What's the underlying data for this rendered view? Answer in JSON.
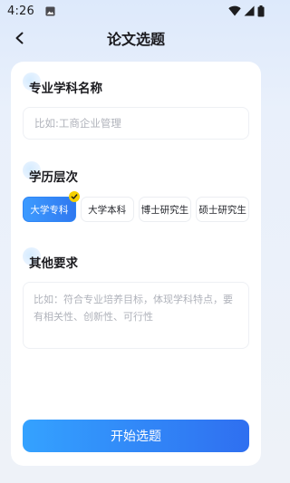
{
  "status_bar": {
    "time": "4:26",
    "icons": [
      "image-icon",
      "wifi-icon",
      "signal-icon",
      "battery-icon"
    ]
  },
  "header": {
    "title": "论文选题",
    "back_icon": "back-arrow-icon"
  },
  "major": {
    "label": "专业学科名称",
    "placeholder": "比如:工商企业管理",
    "value": ""
  },
  "degree": {
    "label": "学历层次",
    "options": [
      "大学专科",
      "大学本科",
      "博士研究生",
      "硕士研究生"
    ],
    "selected": "大学专科"
  },
  "requirements": {
    "label": "其他要求",
    "placeholder": "比如：符合专业培养目标，体现学科特点，要有相关性、创新性、可行性",
    "value": ""
  },
  "actions": {
    "start_label": "开始选题"
  },
  "colors": {
    "accent": "#2f85f5",
    "check_badge": "#f5d000",
    "background": "#e9f0fb"
  }
}
